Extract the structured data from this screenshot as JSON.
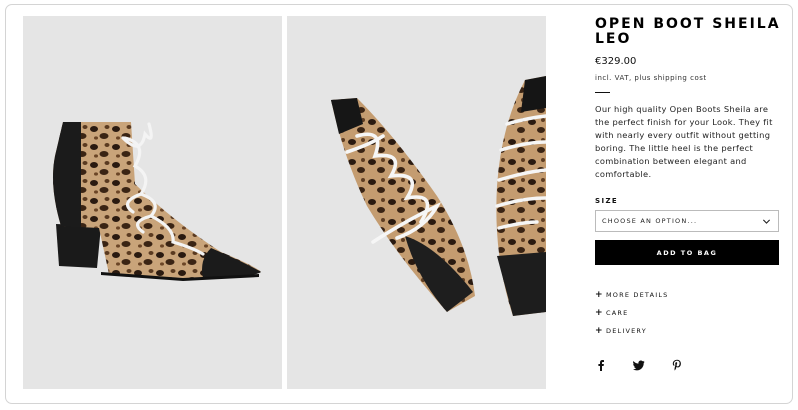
{
  "product": {
    "title": "OPEN BOOT SHEILA LEO",
    "price": "€329.00",
    "tax_note": "incl. VAT, plus shipping cost",
    "description": "Our high quality Open Boots Sheila are the perfect finish for your Look. They fit with nearly every outfit without getting boring. The little heel is the perfect combination between elegant and comfortable."
  },
  "size": {
    "label": "SIZE",
    "selected": "CHOOSE AN OPTION..."
  },
  "add_to_bag_label": "ADD TO BAG",
  "accordion": [
    {
      "label": "MORE DETAILS"
    },
    {
      "label": "CARE"
    },
    {
      "label": "DELIVERY"
    }
  ],
  "social_icons": [
    "facebook-icon",
    "twitter-icon",
    "pinterest-icon"
  ],
  "colors": {
    "photo_background": "#e5e5e5",
    "button": "#000000",
    "text": "#111111"
  }
}
